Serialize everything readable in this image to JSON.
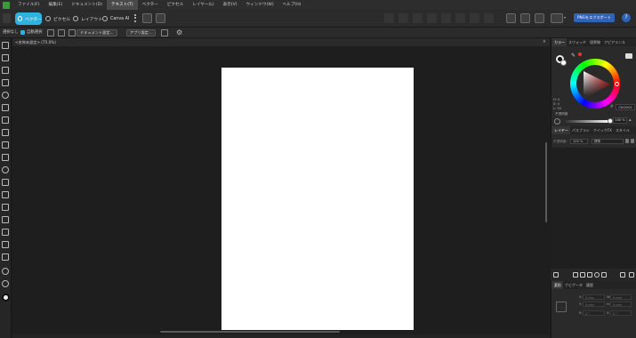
{
  "menu": {
    "items": [
      "ファイル(F)",
      "編集(E)",
      "ドキュメント(D)",
      "テキスト(T)",
      "ベクター",
      "ピクセル",
      "レイヤー(L)",
      "表示(V)",
      "ウィンドウ(W)",
      "ヘルプ(H)"
    ],
    "active_index": 3
  },
  "toolbar": {
    "personas": [
      "ベクター",
      "ピクセル",
      "レイアウト",
      "Canva AI"
    ],
    "active_persona": "ベクター",
    "export_label": "PNGをエクスポート",
    "help_label": "?"
  },
  "context": {
    "selection_label": "選択なし",
    "auto_select_label": "自動選択",
    "doc_settings_label": "ドキュメント設定...",
    "app_settings_label": "アプリ設定..."
  },
  "document": {
    "tab_title": "<名称未設定> (75.0%)",
    "close_label": "×"
  },
  "colors": {
    "accent": "#2eb2e0",
    "export_blue": "#2f63b8",
    "canvas_bg": "#1e1e1e",
    "panel_bg": "#2a2a2a",
    "hex_value": "C0C0C0"
  },
  "color_panel": {
    "tabs": [
      "カラー",
      "スウォッチ",
      "境界線",
      "アピアランス"
    ],
    "active_tab": "カラー",
    "hsl": [
      "H: 0",
      "S: 0",
      "L: 50"
    ],
    "hex": "C0C0C0",
    "opacity_label": "不透明度",
    "opacity_value": "100 %"
  },
  "layers_panel": {
    "tabs": [
      "レイヤー",
      "パスブラシ",
      "クイックFX",
      "スタイル"
    ],
    "active_tab": "レイヤー",
    "opacity_label": "不透明度:",
    "opacity_value": "100 %",
    "blend_mode": "標準"
  },
  "transform_panel": {
    "tabs": [
      "変形",
      "ナビゲータ",
      "履歴"
    ],
    "active_tab": "変形",
    "fields": {
      "x": "X:",
      "x_val": "0 mm",
      "y": "Y:",
      "y_val": "0 mm",
      "w": "W:",
      "w_val": "0 mm",
      "h": "H:",
      "h_val": "0 mm",
      "r": "R:",
      "r_val": "0 °",
      "s": "S:",
      "s_val": "0 °"
    }
  }
}
